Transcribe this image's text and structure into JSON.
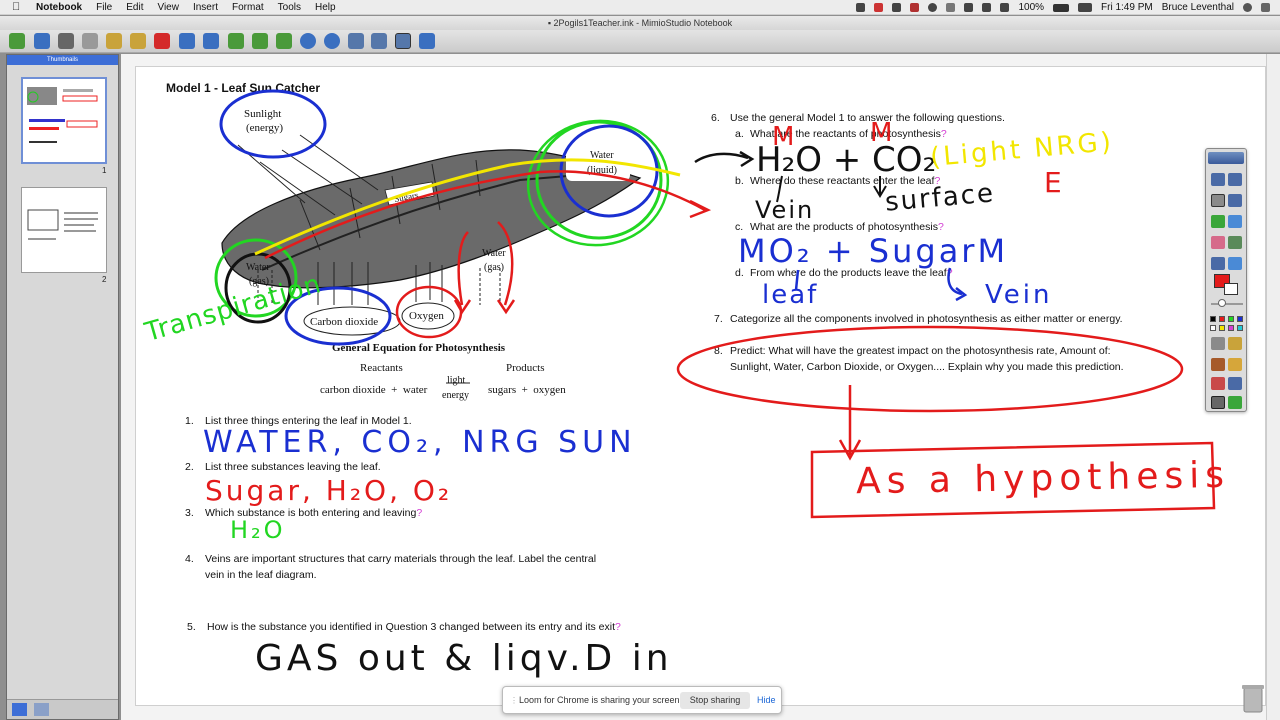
{
  "menubar": {
    "apple": "",
    "app_name": "Notebook",
    "items": [
      "File",
      "Edit",
      "View",
      "Insert",
      "Format",
      "Tools",
      "Help"
    ],
    "battery": "100%",
    "clock": "Fri 1:49 PM",
    "user": "Bruce Leventhal"
  },
  "window": {
    "title": "2Pogils1Teacher.ink - MimioStudio Notebook"
  },
  "thumbnails": {
    "header": "Thumbnails",
    "pages": [
      {
        "number": "1"
      },
      {
        "number": "2"
      }
    ]
  },
  "document": {
    "model_title": "Model 1 - Leaf Sun Catcher",
    "diagram": {
      "sunlight": "Sunlight",
      "energy": "(energy)",
      "water_liquid": "Water",
      "liquid": "(liquid)",
      "sugars": "Sugars",
      "water_gas_left": "Water",
      "gas_left": "(gas)",
      "water_gas_right": "Water",
      "gas_right": "(gas)",
      "carbon_dioxide": "Carbon dioxide",
      "oxygen": "Oxygen",
      "equation_title": "General Equation for Photosynthesis",
      "reactants": "Reactants",
      "products": "Products",
      "equation_left": "carbon dioxide  +  water",
      "light": "light",
      "energy_word": "energy",
      "equation_right": "sugars  +  oxygen"
    },
    "questions_left": [
      {
        "num": "1.",
        "text": "List three things entering the leaf in Model 1."
      },
      {
        "num": "2.",
        "text": "List three substances leaving the leaf."
      },
      {
        "num": "3.",
        "text": "Which substance is both entering and leaving"
      },
      {
        "num": "4.",
        "text": "Veins are important structures that carry materials through the leaf. Label the central"
      },
      {
        "num": "",
        "text": "vein in the leaf diagram."
      },
      {
        "num": "5.",
        "text": "How is the substance you identified in Question 3 changed between its entry and its exit"
      }
    ],
    "questions_right": [
      {
        "num": "6.",
        "text": "Use the general Model 1 to answer the following questions."
      },
      {
        "num": "a.",
        "text": "What are the reactants of photosynthesis"
      },
      {
        "num": "b.",
        "text": "Where do these reactants enter the leaf"
      },
      {
        "num": "c.",
        "text": "What are the products of photosynthesis"
      },
      {
        "num": "d.",
        "text": "From where do the products leave the leaf"
      },
      {
        "num": "7.",
        "text": "Categorize all the components involved in photosynthesis as either matter or energy."
      },
      {
        "num": "8.",
        "text": "Predict: What will have the greatest impact on the photosynthesis rate, Amount of:"
      },
      {
        "num": "",
        "text": "Sunlight, Water, Carbon Dioxide, or Oxygen.... Explain why you made this prediction."
      }
    ],
    "question_mark": "?"
  },
  "annotations": {
    "a1": "WATER, CO₂, NRG SUN",
    "a2": "Sugar, H₂O, O₂",
    "a3": "H₂O",
    "a5": "GAS out & liqv.D in",
    "reactants_eq": "H₂O + CO₂",
    "light_nrg": "(Light NRG)",
    "energy_e": "E",
    "m_left": "M",
    "m_right": "M",
    "vein_b": "Vein",
    "surface_b": "surface",
    "products_c": "MO₂ + SugarM",
    "leaf_d": "leaf",
    "vein_d": "Vein",
    "transpiration": "Transpiration",
    "hypothesis": "As a hypothesis"
  },
  "loom": {
    "message": "Loom for Chrome is sharing your screen.",
    "stop": "Stop sharing",
    "hide": "Hide"
  },
  "colors": {
    "ink_blue": "#1a2fd1",
    "ink_red": "#e31b1b",
    "ink_green": "#22d622",
    "ink_yellow": "#f2e600",
    "ink_black": "#111111",
    "accent_blue": "#3d6ed6"
  }
}
